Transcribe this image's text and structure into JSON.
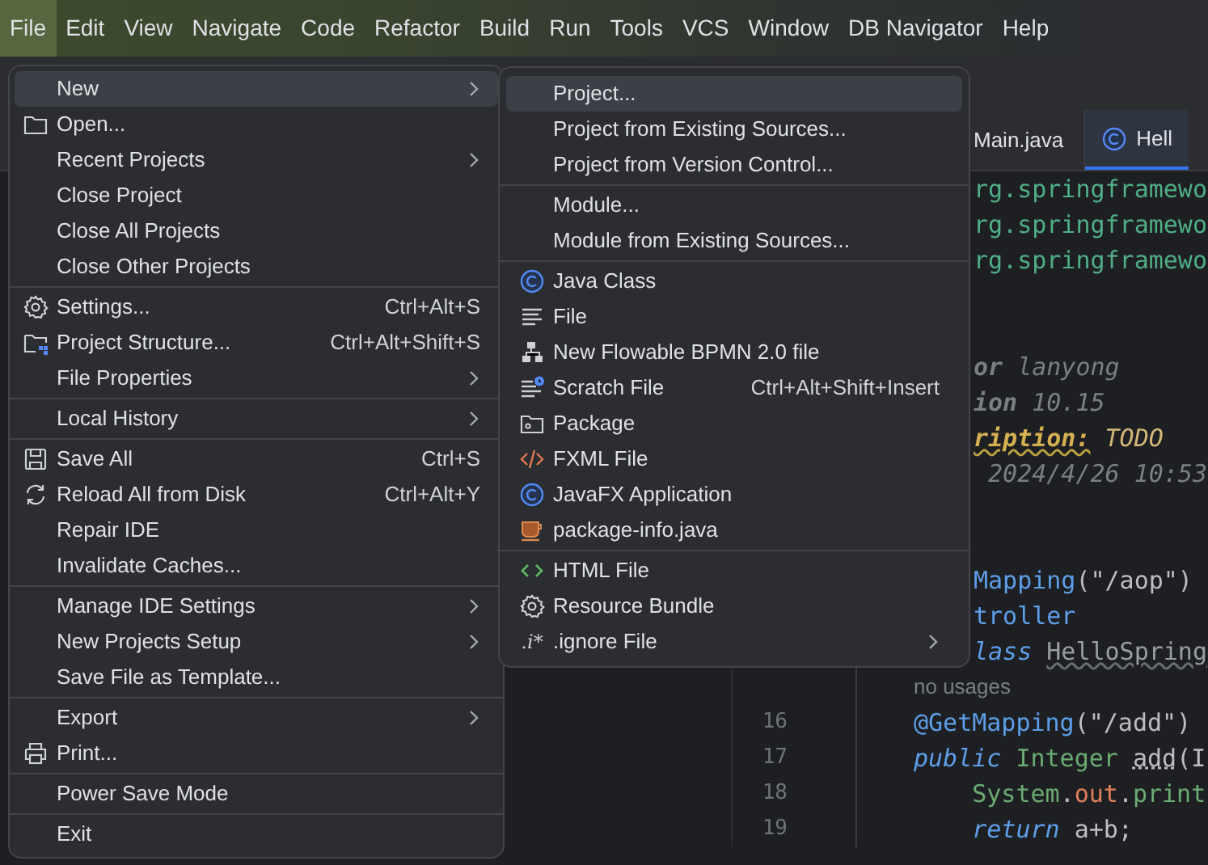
{
  "menu_bar": [
    {
      "label": "File",
      "selected": true
    },
    {
      "label": "Edit",
      "selected": false
    },
    {
      "label": "View",
      "selected": false
    },
    {
      "label": "Navigate",
      "selected": false
    },
    {
      "label": "Code",
      "selected": false
    },
    {
      "label": "Refactor",
      "selected": false
    },
    {
      "label": "Build",
      "selected": false
    },
    {
      "label": "Run",
      "selected": false
    },
    {
      "label": "Tools",
      "selected": false
    },
    {
      "label": "VCS",
      "selected": false
    },
    {
      "label": "Window",
      "selected": false
    },
    {
      "label": "DB Navigator",
      "selected": false
    },
    {
      "label": "Help",
      "selected": false
    }
  ],
  "editor": {
    "tabs": [
      {
        "label": "Main.java",
        "selected": false
      },
      {
        "label": "Hell",
        "selected": true
      }
    ],
    "code_blocks": [
      [
        {
          "clipped": true,
          "tokens": [
            {
              "text": "rg.springframewo",
              "kind": "package"
            }
          ]
        },
        {
          "clipped": true,
          "tokens": [
            {
              "text": "rg.springframewo",
              "kind": "package"
            }
          ]
        },
        {
          "clipped": true,
          "tokens": [
            {
              "text": "rg.springframewo",
              "kind": "package"
            }
          ]
        }
      ],
      [
        {
          "clipped": true,
          "tokens": [
            {
              "text": "or",
              "kind": "doc_tag"
            },
            {
              "text": " lanyong",
              "kind": "doc"
            }
          ]
        },
        {
          "clipped": true,
          "tokens": [
            {
              "text": "ion",
              "kind": "doc_tag"
            },
            {
              "text": " 10.15",
              "kind": "doc"
            }
          ]
        },
        {
          "clipped": true,
          "tokens": [
            {
              "text": "ription:",
              "kind": "todo_tag"
            },
            {
              "text": " TODO",
              "kind": "todo"
            }
          ]
        },
        {
          "clipped": true,
          "tokens": [
            {
              "text": " 2024/4/26 10:53",
              "kind": "doc"
            }
          ]
        }
      ],
      [
        {
          "clipped": true,
          "tokens": [
            {
              "text": "Mapping",
              "kind": "annotation"
            },
            {
              "text": "(\"/aop\")",
              "kind": "plain"
            }
          ]
        },
        {
          "clipped": true,
          "tokens": [
            {
              "text": "troller",
              "kind": "annotation"
            }
          ]
        },
        {
          "clipped": true,
          "tokens": [
            {
              "text": "lass ",
              "kind": "keyword"
            },
            {
              "text": "HelloSpring",
              "kind": "unused"
            }
          ]
        },
        {
          "hint": "no usages"
        },
        {
          "number": "16",
          "tokens": [
            {
              "text": "@GetMapping",
              "kind": "annotation"
            },
            {
              "text": "(\"/add\")",
              "kind": "plain"
            }
          ]
        },
        {
          "number": "17",
          "tokens": [
            {
              "text": "public ",
              "kind": "keyword"
            },
            {
              "text": "Integer ",
              "kind": "type"
            },
            {
              "text": "add",
              "kind": "method_unused"
            },
            {
              "text": "(I",
              "kind": "plain"
            }
          ]
        },
        {
          "number": "18",
          "tokens": [
            {
              "text": "    System",
              "kind": "type"
            },
            {
              "text": ".",
              "kind": "plain"
            },
            {
              "text": "out",
              "kind": "field"
            },
            {
              "text": ".",
              "kind": "plain"
            },
            {
              "text": "print",
              "kind": "type"
            }
          ]
        },
        {
          "number": "19",
          "tokens": [
            {
              "text": "    return",
              "kind": "keyword"
            },
            {
              "text": " a+b;",
              "kind": "plain"
            }
          ]
        }
      ]
    ]
  },
  "file_menu": [
    [
      {
        "label": "New",
        "submenu": true,
        "selected": true
      },
      {
        "label": "Open...",
        "submenu": false,
        "selected": false
      },
      {
        "label": "Recent Projects",
        "submenu": true,
        "selected": false
      },
      {
        "label": "Close Project",
        "submenu": false,
        "selected": false
      },
      {
        "label": "Close All Projects",
        "submenu": false,
        "selected": false
      },
      {
        "label": "Close Other Projects",
        "submenu": false,
        "selected": false
      }
    ],
    [
      {
        "label": "Settings...",
        "shortcut": "Ctrl+Alt+S",
        "submenu": false,
        "selected": false
      },
      {
        "label": "Project Structure...",
        "shortcut": "Ctrl+Alt+Shift+S",
        "submenu": false,
        "selected": false
      },
      {
        "label": "File Properties",
        "submenu": true,
        "selected": false
      }
    ],
    [
      {
        "label": "Local History",
        "submenu": true,
        "selected": false
      }
    ],
    [
      {
        "label": "Save All",
        "shortcut": "Ctrl+S",
        "submenu": false,
        "selected": false
      },
      {
        "label": "Reload All from Disk",
        "shortcut": "Ctrl+Alt+Y",
        "submenu": false,
        "selected": false
      },
      {
        "label": "Repair IDE",
        "submenu": false,
        "selected": false
      },
      {
        "label": "Invalidate Caches...",
        "submenu": false,
        "selected": false
      }
    ],
    [
      {
        "label": "Manage IDE Settings",
        "submenu": true,
        "selected": false
      },
      {
        "label": "New Projects Setup",
        "submenu": true,
        "selected": false
      },
      {
        "label": "Save File as Template...",
        "submenu": false,
        "selected": false
      }
    ],
    [
      {
        "label": "Export",
        "submenu": true,
        "selected": false
      },
      {
        "label": "Print...",
        "submenu": false,
        "selected": false
      }
    ],
    [
      {
        "label": "Power Save Mode",
        "submenu": false,
        "selected": false
      }
    ],
    [
      {
        "label": "Exit",
        "submenu": false,
        "selected": false
      }
    ]
  ],
  "new_submenu": [
    [
      {
        "label": "Project...",
        "submenu": false,
        "selected": true
      },
      {
        "label": "Project from Existing Sources...",
        "submenu": false,
        "selected": false
      },
      {
        "label": "Project from Version Control...",
        "submenu": false,
        "selected": false
      }
    ],
    [
      {
        "label": "Module...",
        "submenu": false,
        "selected": false
      },
      {
        "label": "Module from Existing Sources...",
        "submenu": false,
        "selected": false
      }
    ],
    [
      {
        "label": "Java Class",
        "submenu": false,
        "selected": false
      },
      {
        "label": "File",
        "submenu": false,
        "selected": false
      },
      {
        "label": "New Flowable BPMN 2.0 file",
        "submenu": false,
        "selected": false
      },
      {
        "label": "Scratch File",
        "shortcut": "Ctrl+Alt+Shift+Insert",
        "submenu": false,
        "selected": false
      },
      {
        "label": "Package",
        "submenu": false,
        "selected": false
      },
      {
        "label": "FXML File",
        "submenu": false,
        "selected": false
      },
      {
        "label": "JavaFX Application",
        "submenu": false,
        "selected": false
      },
      {
        "label": "package-info.java",
        "submenu": false,
        "selected": false
      }
    ],
    [
      {
        "label": "HTML File",
        "submenu": false,
        "selected": false
      },
      {
        "label": "Resource Bundle",
        "submenu": false,
        "selected": false
      },
      {
        "label": ".ignore File",
        "icon_text": ".i*",
        "submenu": true,
        "selected": false
      }
    ]
  ]
}
